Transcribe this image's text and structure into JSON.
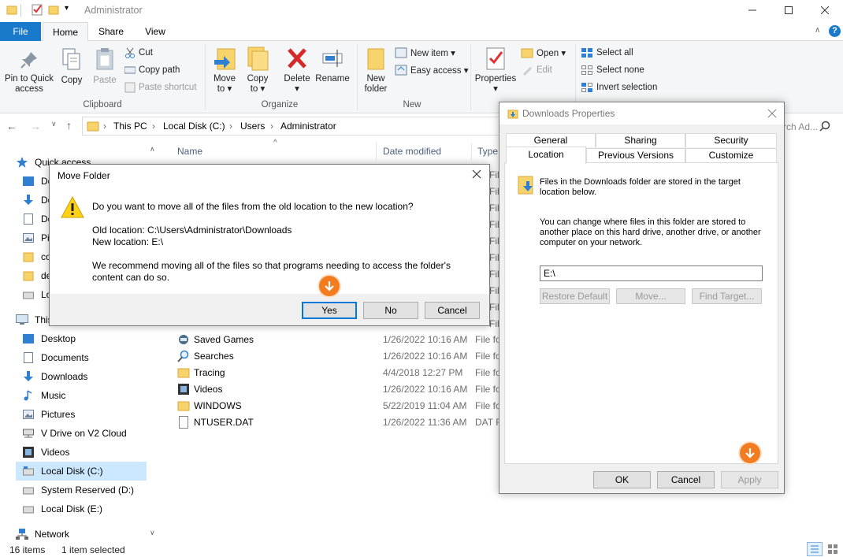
{
  "window": {
    "title": "Administrator"
  },
  "tabs": {
    "file": "File",
    "home": "Home",
    "share": "Share",
    "view": "View"
  },
  "ribbon": {
    "pin": "Pin to Quick\naccess",
    "copy": "Copy",
    "paste": "Paste",
    "cut": "Cut",
    "copy_path": "Copy path",
    "paste_shortcut": "Paste shortcut",
    "clipboard": "Clipboard",
    "move_to": "Move\nto ▾",
    "copy_to": "Copy\nto ▾",
    "delete": "Delete\n▾",
    "rename": "Rename",
    "organize": "Organize",
    "new_folder": "New\nfolder",
    "new_item": "New item ▾",
    "easy_access": "Easy access ▾",
    "new": "New",
    "properties": "Properties\n▾",
    "open": "Open ▾",
    "edit": "Edit",
    "select_all": "Select all",
    "select_none": "Select none",
    "invert_selection": "Invert selection"
  },
  "address": {
    "crumbs": [
      "This PC",
      "Local Disk (C:)",
      "Users",
      "Administrator"
    ],
    "search_partial": "rch Ad..."
  },
  "columns": {
    "name": "Name",
    "date": "Date modified",
    "type": "Type"
  },
  "nav": {
    "quick_access": "Quick access",
    "qa_items": [
      "De",
      "Do",
      "Do",
      "Pic",
      "co",
      "de",
      "Lo"
    ],
    "this_pc": "This",
    "pc_items": [
      "Desktop",
      "Documents",
      "Downloads",
      "Music",
      "Pictures",
      "V Drive on V2 Cloud",
      "Videos",
      "Local Disk (C:)",
      "System Reserved (D:)",
      "Local Disk (E:)"
    ],
    "network": "Network"
  },
  "partial_types": [
    "File fo",
    "File fo",
    "File fo",
    "File fo",
    "File fo",
    "File fo",
    "File fo",
    "File fo",
    "File fo",
    "File fo"
  ],
  "files": [
    {
      "name": "Saved Games",
      "date": "1/26/2022 10:16 AM",
      "type": "File fo"
    },
    {
      "name": "Searches",
      "date": "1/26/2022 10:16 AM",
      "type": "File fo"
    },
    {
      "name": "Tracing",
      "date": "4/4/2018 12:27 PM",
      "type": "File fo"
    },
    {
      "name": "Videos",
      "date": "1/26/2022 10:16 AM",
      "type": "File fo"
    },
    {
      "name": "WINDOWS",
      "date": "5/22/2019 11:04 AM",
      "type": "File fo"
    },
    {
      "name": "NTUSER.DAT",
      "date": "1/26/2022 11:36 AM",
      "type": "DAT F"
    }
  ],
  "status": {
    "count": "16 items",
    "selected": "1 item selected"
  },
  "move_dialog": {
    "title": "Move Folder",
    "question": "Do you want to move all of the files from the old location to the new location?",
    "old": "Old location: C:\\Users\\Administrator\\Downloads",
    "new": "New location: E:\\",
    "recommend1": "We recommend moving all of the files so that programs needing to access the folder's",
    "recommend2": "content can do so.",
    "yes": "Yes",
    "no": "No",
    "cancel": "Cancel"
  },
  "props": {
    "title": "Downloads Properties",
    "tabs_row1": [
      "General",
      "Sharing",
      "Security"
    ],
    "tabs_row2": [
      "Location",
      "Previous Versions",
      "Customize"
    ],
    "info1": "Files in the Downloads folder are stored in the target",
    "info2": "location below.",
    "change1": "You can change where files in this folder are stored to",
    "change2": "another place on this hard drive, another drive, or another",
    "change3": "computer on your network.",
    "path": "E:\\",
    "restore": "Restore Default",
    "move": "Move...",
    "find": "Find Target...",
    "ok": "OK",
    "cancel": "Cancel",
    "apply": "Apply"
  }
}
